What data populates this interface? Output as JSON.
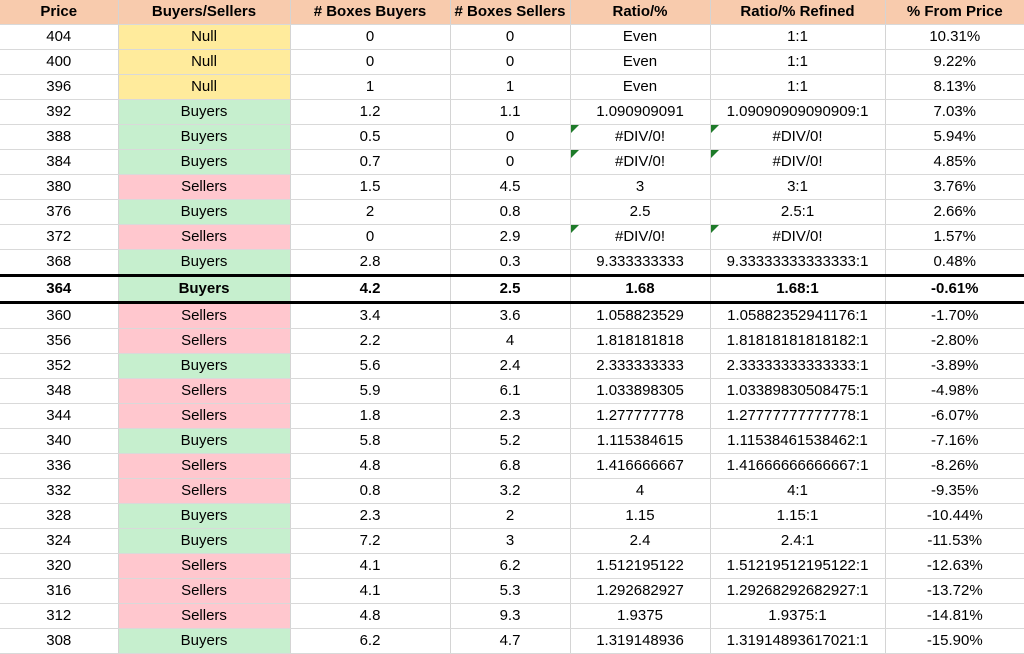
{
  "table": {
    "columns": [
      {
        "key": "price",
        "label": "Price"
      },
      {
        "key": "status",
        "label": "Buyers/Sellers"
      },
      {
        "key": "boxes_buy",
        "label": "# Boxes Buyers"
      },
      {
        "key": "boxes_sell",
        "label": "# Boxes Sellers"
      },
      {
        "key": "ratio",
        "label": "Ratio/%"
      },
      {
        "key": "ratio_ref",
        "label": "Ratio/% Refined"
      },
      {
        "key": "pct",
        "label": "% From Price"
      }
    ],
    "colors": {
      "header_bg": "#f8cbad",
      "header_text": "#3f3f76",
      "null_bg": "#ffeb9c",
      "null_text": "#9c6500",
      "buyers_bg": "#c6efce",
      "buyers_text": "#006100",
      "sellers_bg": "#ffc7ce",
      "sellers_text": "#9c0006",
      "error_flag": "#1e7b29",
      "highlight_border": "#000000"
    },
    "rows": [
      {
        "price": "404",
        "status": "Null",
        "boxes_buy": "0",
        "boxes_sell": "0",
        "ratio": "Even",
        "ratio_ref": "1:1",
        "pct": "10.31%",
        "highlight": false,
        "ratio_error": false
      },
      {
        "price": "400",
        "status": "Null",
        "boxes_buy": "0",
        "boxes_sell": "0",
        "ratio": "Even",
        "ratio_ref": "1:1",
        "pct": "9.22%",
        "highlight": false,
        "ratio_error": false
      },
      {
        "price": "396",
        "status": "Null",
        "boxes_buy": "1",
        "boxes_sell": "1",
        "ratio": "Even",
        "ratio_ref": "1:1",
        "pct": "8.13%",
        "highlight": false,
        "ratio_error": false
      },
      {
        "price": "392",
        "status": "Buyers",
        "boxes_buy": "1.2",
        "boxes_sell": "1.1",
        "ratio": "1.090909091",
        "ratio_ref": "1.09090909090909:1",
        "pct": "7.03%",
        "highlight": false,
        "ratio_error": false
      },
      {
        "price": "388",
        "status": "Buyers",
        "boxes_buy": "0.5",
        "boxes_sell": "0",
        "ratio": "#DIV/0!",
        "ratio_ref": "#DIV/0!",
        "pct": "5.94%",
        "highlight": false,
        "ratio_error": true
      },
      {
        "price": "384",
        "status": "Buyers",
        "boxes_buy": "0.7",
        "boxes_sell": "0",
        "ratio": "#DIV/0!",
        "ratio_ref": "#DIV/0!",
        "pct": "4.85%",
        "highlight": false,
        "ratio_error": true
      },
      {
        "price": "380",
        "status": "Sellers",
        "boxes_buy": "1.5",
        "boxes_sell": "4.5",
        "ratio": "3",
        "ratio_ref": "3:1",
        "pct": "3.76%",
        "highlight": false,
        "ratio_error": false
      },
      {
        "price": "376",
        "status": "Buyers",
        "boxes_buy": "2",
        "boxes_sell": "0.8",
        "ratio": "2.5",
        "ratio_ref": "2.5:1",
        "pct": "2.66%",
        "highlight": false,
        "ratio_error": false
      },
      {
        "price": "372",
        "status": "Sellers",
        "boxes_buy": "0",
        "boxes_sell": "2.9",
        "ratio": "#DIV/0!",
        "ratio_ref": "#DIV/0!",
        "pct": "1.57%",
        "highlight": false,
        "ratio_error": true
      },
      {
        "price": "368",
        "status": "Buyers",
        "boxes_buy": "2.8",
        "boxes_sell": "0.3",
        "ratio": "9.333333333",
        "ratio_ref": "9.33333333333333:1",
        "pct": "0.48%",
        "highlight": false,
        "ratio_error": false
      },
      {
        "price": "364",
        "status": "Buyers",
        "boxes_buy": "4.2",
        "boxes_sell": "2.5",
        "ratio": "1.68",
        "ratio_ref": "1.68:1",
        "pct": "-0.61%",
        "highlight": true,
        "ratio_error": false
      },
      {
        "price": "360",
        "status": "Sellers",
        "boxes_buy": "3.4",
        "boxes_sell": "3.6",
        "ratio": "1.058823529",
        "ratio_ref": "1.05882352941176:1",
        "pct": "-1.70%",
        "highlight": false,
        "ratio_error": false
      },
      {
        "price": "356",
        "status": "Sellers",
        "boxes_buy": "2.2",
        "boxes_sell": "4",
        "ratio": "1.818181818",
        "ratio_ref": "1.81818181818182:1",
        "pct": "-2.80%",
        "highlight": false,
        "ratio_error": false
      },
      {
        "price": "352",
        "status": "Buyers",
        "boxes_buy": "5.6",
        "boxes_sell": "2.4",
        "ratio": "2.333333333",
        "ratio_ref": "2.33333333333333:1",
        "pct": "-3.89%",
        "highlight": false,
        "ratio_error": false
      },
      {
        "price": "348",
        "status": "Sellers",
        "boxes_buy": "5.9",
        "boxes_sell": "6.1",
        "ratio": "1.033898305",
        "ratio_ref": "1.03389830508475:1",
        "pct": "-4.98%",
        "highlight": false,
        "ratio_error": false
      },
      {
        "price": "344",
        "status": "Sellers",
        "boxes_buy": "1.8",
        "boxes_sell": "2.3",
        "ratio": "1.277777778",
        "ratio_ref": "1.27777777777778:1",
        "pct": "-6.07%",
        "highlight": false,
        "ratio_error": false
      },
      {
        "price": "340",
        "status": "Buyers",
        "boxes_buy": "5.8",
        "boxes_sell": "5.2",
        "ratio": "1.115384615",
        "ratio_ref": "1.11538461538462:1",
        "pct": "-7.16%",
        "highlight": false,
        "ratio_error": false
      },
      {
        "price": "336",
        "status": "Sellers",
        "boxes_buy": "4.8",
        "boxes_sell": "6.8",
        "ratio": "1.416666667",
        "ratio_ref": "1.41666666666667:1",
        "pct": "-8.26%",
        "highlight": false,
        "ratio_error": false
      },
      {
        "price": "332",
        "status": "Sellers",
        "boxes_buy": "0.8",
        "boxes_sell": "3.2",
        "ratio": "4",
        "ratio_ref": "4:1",
        "pct": "-9.35%",
        "highlight": false,
        "ratio_error": false
      },
      {
        "price": "328",
        "status": "Buyers",
        "boxes_buy": "2.3",
        "boxes_sell": "2",
        "ratio": "1.15",
        "ratio_ref": "1.15:1",
        "pct": "-10.44%",
        "highlight": false,
        "ratio_error": false
      },
      {
        "price": "324",
        "status": "Buyers",
        "boxes_buy": "7.2",
        "boxes_sell": "3",
        "ratio": "2.4",
        "ratio_ref": "2.4:1",
        "pct": "-11.53%",
        "highlight": false,
        "ratio_error": false
      },
      {
        "price": "320",
        "status": "Sellers",
        "boxes_buy": "4.1",
        "boxes_sell": "6.2",
        "ratio": "1.512195122",
        "ratio_ref": "1.51219512195122:1",
        "pct": "-12.63%",
        "highlight": false,
        "ratio_error": false
      },
      {
        "price": "316",
        "status": "Sellers",
        "boxes_buy": "4.1",
        "boxes_sell": "5.3",
        "ratio": "1.292682927",
        "ratio_ref": "1.29268292682927:1",
        "pct": "-13.72%",
        "highlight": false,
        "ratio_error": false
      },
      {
        "price": "312",
        "status": "Sellers",
        "boxes_buy": "4.8",
        "boxes_sell": "9.3",
        "ratio": "1.9375",
        "ratio_ref": "1.9375:1",
        "pct": "-14.81%",
        "highlight": false,
        "ratio_error": false
      },
      {
        "price": "308",
        "status": "Buyers",
        "boxes_buy": "6.2",
        "boxes_sell": "4.7",
        "ratio": "1.319148936",
        "ratio_ref": "1.31914893617021:1",
        "pct": "-15.90%",
        "highlight": false,
        "ratio_error": false
      }
    ]
  }
}
